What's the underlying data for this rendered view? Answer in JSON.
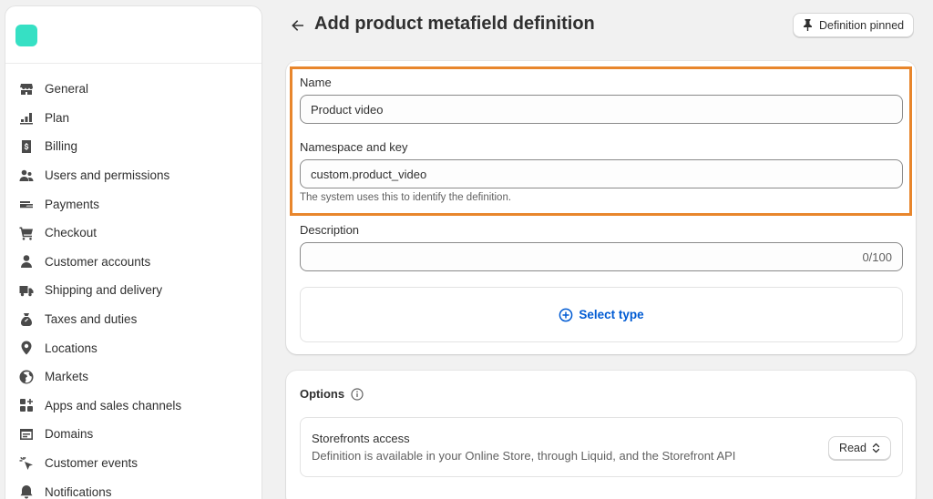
{
  "sidebar": {
    "items": [
      {
        "label": "General",
        "icon": "store-icon"
      },
      {
        "label": "Plan",
        "icon": "plan-chart-icon"
      },
      {
        "label": "Billing",
        "icon": "billing-dollar-icon"
      },
      {
        "label": "Users and permissions",
        "icon": "users-icon"
      },
      {
        "label": "Payments",
        "icon": "payments-hand-icon"
      },
      {
        "label": "Checkout",
        "icon": "cart-icon"
      },
      {
        "label": "Customer accounts",
        "icon": "person-icon"
      },
      {
        "label": "Shipping and delivery",
        "icon": "truck-icon"
      },
      {
        "label": "Taxes and duties",
        "icon": "tax-bag-icon"
      },
      {
        "label": "Locations",
        "icon": "location-pin-icon"
      },
      {
        "label": "Markets",
        "icon": "globe-icon"
      },
      {
        "label": "Apps and sales channels",
        "icon": "apps-icon"
      },
      {
        "label": "Domains",
        "icon": "globe-window-icon"
      },
      {
        "label": "Customer events",
        "icon": "cursor-click-icon"
      },
      {
        "label": "Notifications",
        "icon": "bell-icon"
      }
    ]
  },
  "header": {
    "title": "Add product metafield definition",
    "pin_label": "Definition pinned"
  },
  "form": {
    "name_label": "Name",
    "name_value": "Product video",
    "namespace_label": "Namespace and key",
    "namespace_value": "custom.product_video",
    "namespace_help": "The system uses this to identify the definition.",
    "description_label": "Description",
    "description_value": "",
    "description_counter": "0/100",
    "select_type_label": "Select type"
  },
  "options": {
    "title": "Options",
    "storefronts_title": "Storefronts access",
    "storefronts_desc": "Definition is available in your Online Store, through Liquid, and the Storefront API",
    "access_value": "Read"
  },
  "colors": {
    "accent": "#005bd3",
    "highlight": "#e8862c",
    "logo": "#36e0c4"
  }
}
